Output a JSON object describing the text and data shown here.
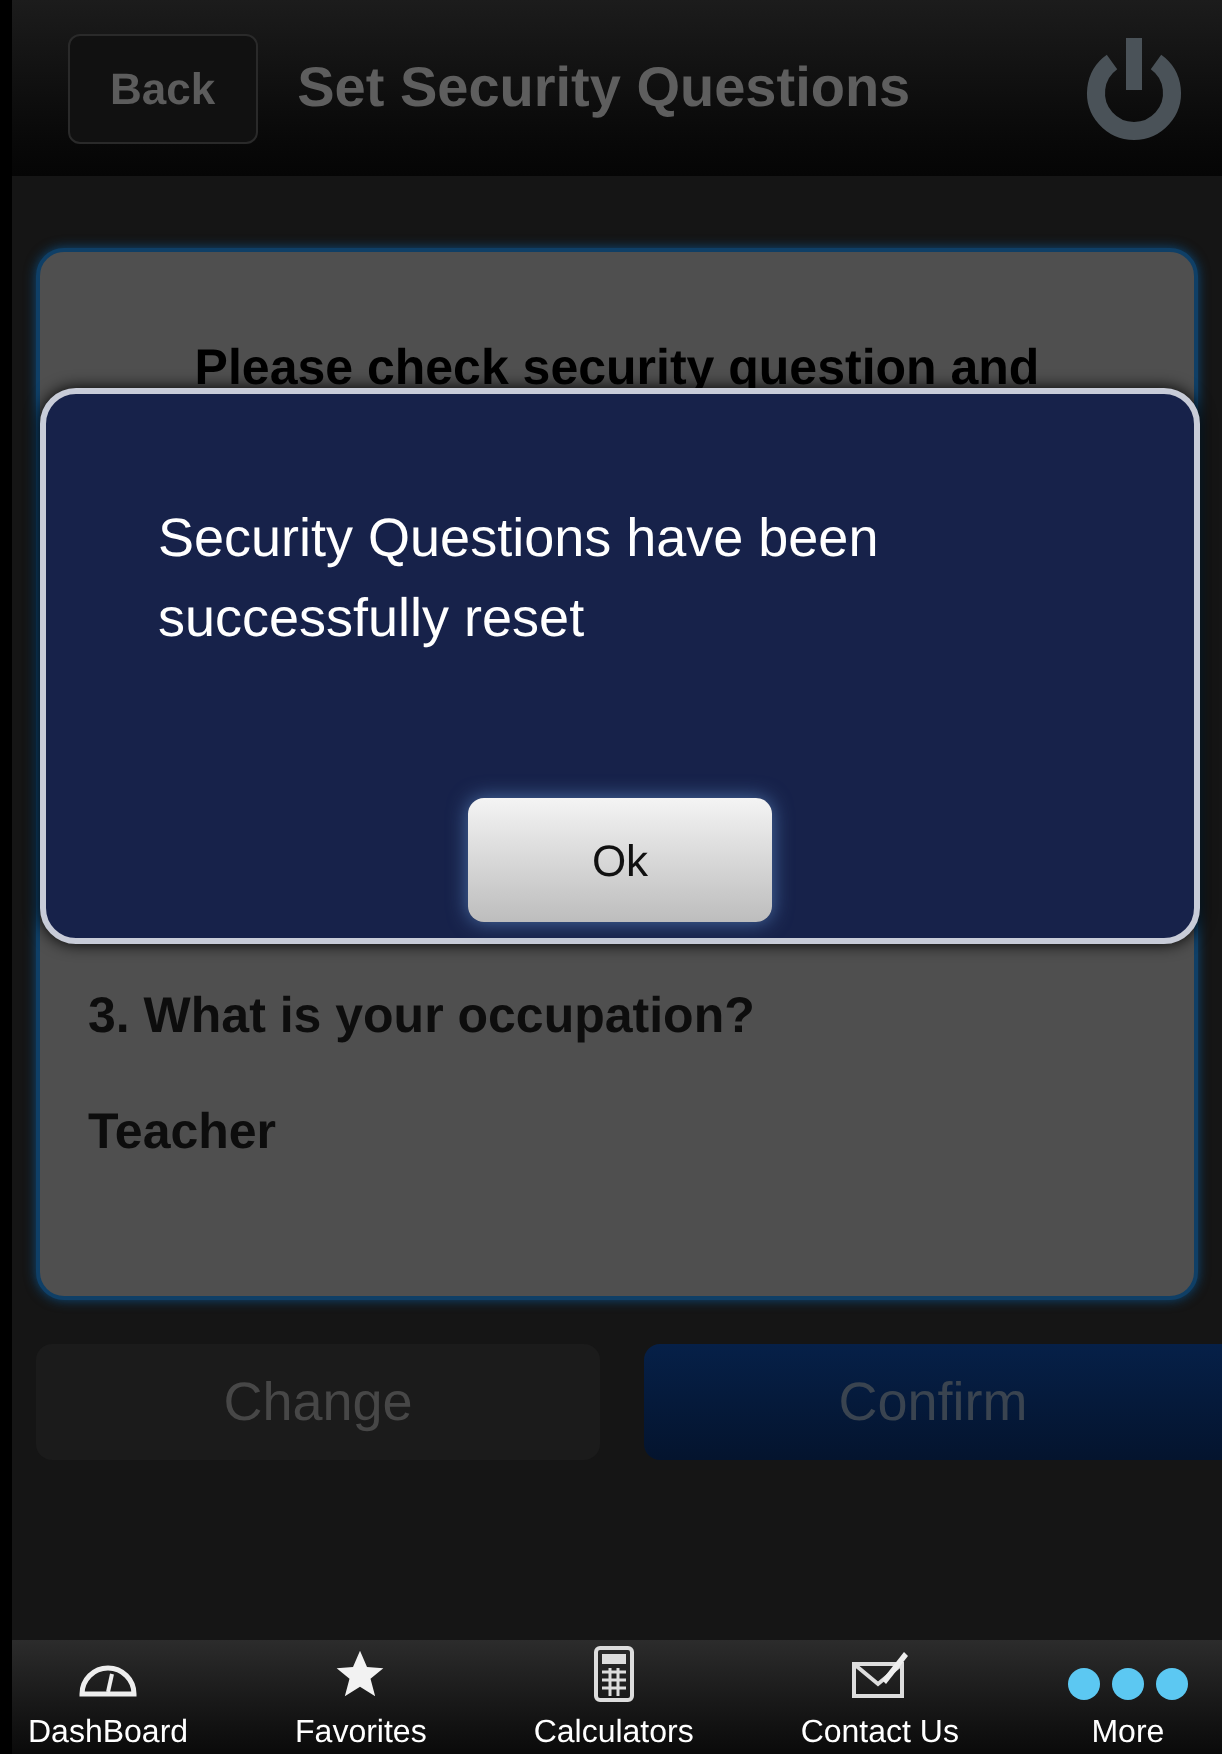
{
  "nav_bar": {
    "back": "Back",
    "title": "Set Security Questions"
  },
  "card": {
    "intro": "Please check security question and",
    "questions": [
      {
        "question": "3. What is your occupation?",
        "answer": "Teacher"
      }
    ]
  },
  "buttons": [
    {
      "label": "Change",
      "kind": "plain"
    },
    {
      "label": "Confirm",
      "kind": "primary"
    }
  ],
  "alert": {
    "message": "Security Questions have been successfully reset",
    "button": "Ok"
  },
  "tab_bar": [
    {
      "label": "DashBoard",
      "kind": "gauge"
    },
    {
      "label": "Favorites",
      "kind": "star"
    },
    {
      "label": "Calculators",
      "kind": "calculator"
    },
    {
      "label": "Contact Us",
      "kind": "mail"
    },
    {
      "label": "More",
      "kind": "more"
    }
  ]
}
